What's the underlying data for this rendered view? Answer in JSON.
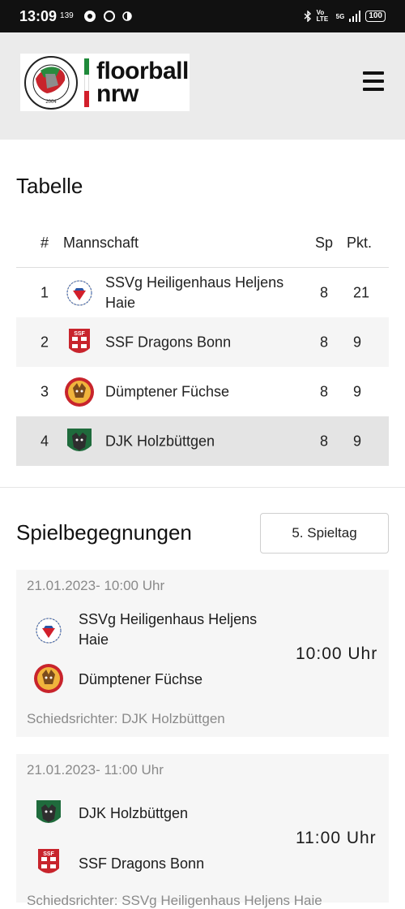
{
  "status_bar": {
    "time": "13:09",
    "sub": "139",
    "network": "Vo LTE",
    "network2": "5G",
    "battery": "100"
  },
  "header": {
    "logo_text_line1": "floorball",
    "logo_text_line2": "nrw",
    "seal_year": "2004",
    "flag_colors": [
      "#1f8a3a",
      "#ffffff",
      "#d21f2b"
    ]
  },
  "standings": {
    "title": "Tabelle",
    "headers": {
      "rank": "#",
      "team": "Mannschaft",
      "games": "Sp",
      "points": "Pkt."
    },
    "rows": [
      {
        "rank": "1",
        "team": "SSVg Heiligenhaus Heljens Haie",
        "games": "8",
        "points": "21",
        "logo": "heiligenhaus-logo"
      },
      {
        "rank": "2",
        "team": "SSF Dragons Bonn",
        "games": "8",
        "points": "9",
        "logo": "bonn-logo"
      },
      {
        "rank": "3",
        "team": "Dümptener Füchse",
        "games": "8",
        "points": "9",
        "logo": "duemptener-logo"
      },
      {
        "rank": "4",
        "team": "DJK Holzbüttgen",
        "games": "8",
        "points": "9",
        "logo": "holzbuettgen-logo"
      }
    ]
  },
  "matches": {
    "title": "Spielbegegnungen",
    "matchday_button": "5. Spieltag",
    "items": [
      {
        "date": "21.01.2023- 10:00 Uhr",
        "home": "SSVg Heiligenhaus Heljens Haie",
        "away": "Dümptener Füchse",
        "time": "10:00 Uhr",
        "referee": "Schiedsrichter: DJK Holzbüttgen"
      },
      {
        "date": "21.01.2023- 11:00 Uhr",
        "home": "DJK Holzbüttgen",
        "away": "SSF Dragons Bonn",
        "time": "11:00 Uhr",
        "referee": "Schiedsrichter: SSVg Heiligenhaus Heljens Haie"
      }
    ]
  }
}
